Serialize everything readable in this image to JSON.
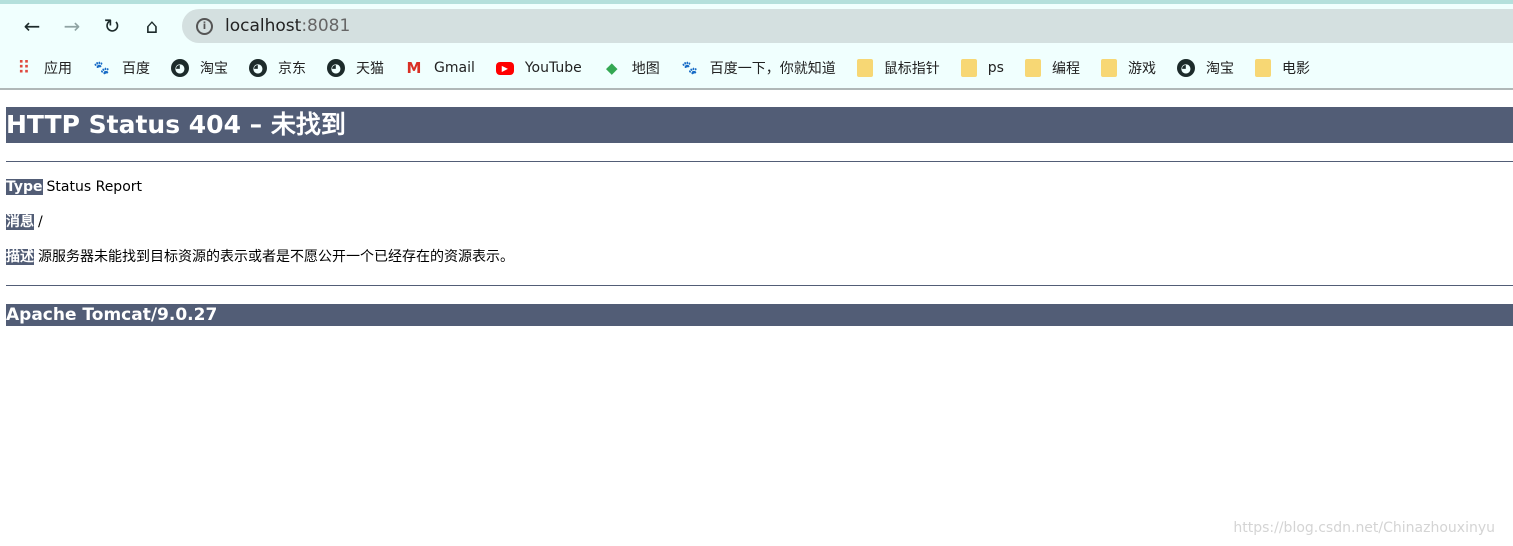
{
  "browser": {
    "url_host": "localhost",
    "url_port": ":8081",
    "bookmarks": [
      {
        "label": "应用",
        "icon": "apps-grid-icon"
      },
      {
        "label": "百度",
        "icon": "baidu-paw-icon"
      },
      {
        "label": "淘宝",
        "icon": "globe-icon"
      },
      {
        "label": "京东",
        "icon": "globe-icon"
      },
      {
        "label": "天猫",
        "icon": "globe-icon"
      },
      {
        "label": "Gmail",
        "icon": "gmail-icon"
      },
      {
        "label": "YouTube",
        "icon": "youtube-icon"
      },
      {
        "label": "地图",
        "icon": "maps-icon"
      },
      {
        "label": "百度一下，你就知道",
        "icon": "baidu-paw-icon"
      },
      {
        "label": "鼠标指针",
        "icon": "folder-icon"
      },
      {
        "label": "ps",
        "icon": "folder-icon"
      },
      {
        "label": "编程",
        "icon": "folder-icon"
      },
      {
        "label": "游戏",
        "icon": "folder-icon"
      },
      {
        "label": "淘宝",
        "icon": "globe-icon"
      },
      {
        "label": "电影",
        "icon": "folder-icon"
      }
    ]
  },
  "page": {
    "title": "HTTP Status 404 – 未找到",
    "type_label": "Type",
    "type_value": "Status Report",
    "message_label": "消息",
    "message_value": "/",
    "description_label": "描述",
    "description_value": "源服务器未能找到目标资源的表示或者是不愿公开一个已经存在的资源表示。",
    "footer": "Apache Tomcat/9.0.27"
  },
  "watermark": "https://blog.csdn.net/Chinazhouxinyu",
  "colors": {
    "header_bg": "#525D76",
    "browser_bg": "#f0fffe"
  }
}
